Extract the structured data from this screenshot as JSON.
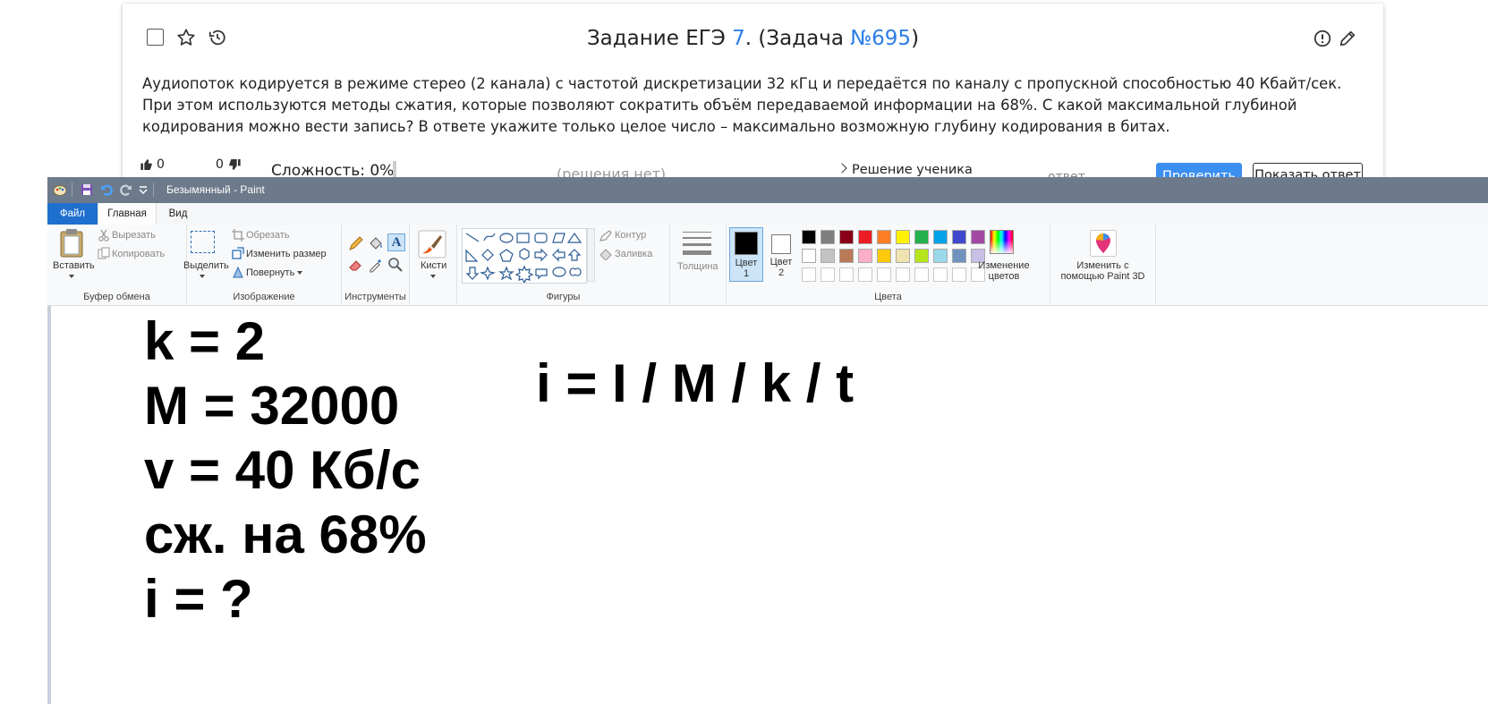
{
  "task": {
    "title_prefix": "Задание ЕГЭ ",
    "title_num": "7",
    "title_mid": ". (Задача ",
    "title_link": "№695",
    "title_suffix": ")",
    "text": "Аудиопоток кодируется в режиме стерео (2 канала) с частотой дискретизации 32 кГц и передаётся по каналу с пропускной способностью 40 Кбайт/сек. При этом используются методы сжатия, которые позволяют сократить объём передаваемой информации на 68%. С какой максимальной глубиной кодирования можно вести запись? В ответе укажите только целое число – максимально возможную глубину кодирования в битах.",
    "likes": "0",
    "dislikes": "0",
    "difficulty": "Сложность: 0%",
    "no_solutions": "(решения нет)",
    "student_solution": "Решение ученика",
    "answer_label": "ответ",
    "check_button": "Проверить",
    "show_answer_button": "Показать ответ"
  },
  "paint": {
    "window_title": "Безымянный - Paint",
    "tabs": [
      "Файл",
      "Главная",
      "Вид"
    ],
    "groups": {
      "clipboard": "Буфер обмена",
      "image": "Изображение",
      "tools": "Инструменты",
      "shapes": "Фигуры",
      "colors": "Цвета"
    },
    "clipboard": {
      "paste": "Вставить",
      "cut": "Вырезать",
      "copy": "Копировать"
    },
    "image": {
      "select": "Выделить",
      "crop": "Обрезать",
      "resize": "Изменить размер",
      "rotate": "Повернуть"
    },
    "brushes": "Кисти",
    "shape_opts": {
      "outline": "Контур",
      "fill": "Заливка"
    },
    "thickness": "Толщина",
    "color1": {
      "line1": "Цвет",
      "line2": "1"
    },
    "color2": {
      "line1": "Цвет",
      "line2": "2"
    },
    "edit_colors": {
      "line1": "Изменение",
      "line2": "цветов"
    },
    "paint3d": {
      "line1": "Изменить с",
      "line2": "помощью Paint 3D"
    },
    "palette_row1": [
      "#000000",
      "#7f7f7f",
      "#880015",
      "#ed1c24",
      "#ff7f27",
      "#fff200",
      "#22b14c",
      "#00a2e8",
      "#3f48cc",
      "#a349a4"
    ],
    "palette_row2": [
      "#ffffff",
      "#c3c3c3",
      "#b97a57",
      "#ffaec9",
      "#ffc90e",
      "#efe4b0",
      "#b5e61d",
      "#99d9ea",
      "#7092be",
      "#c8bfe7"
    ],
    "primary_color": "#000000",
    "secondary_color": "#ffffff"
  },
  "canvas_text": {
    "lines": [
      "k = 2",
      "M = 32000",
      "v = 40 Кб/с",
      "сж. на 68%",
      "i = ?"
    ],
    "formula": "i = I / M / k / t"
  }
}
